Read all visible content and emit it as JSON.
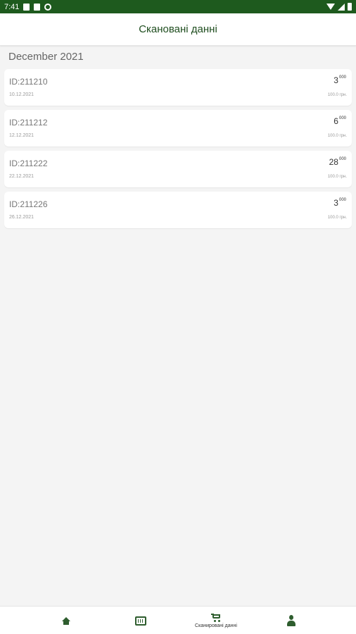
{
  "status_bar": {
    "time": "7:41"
  },
  "app_bar": {
    "title": "Скановані данні"
  },
  "section": {
    "header": "December 2021"
  },
  "items": [
    {
      "id": "ID:211210",
      "date": "10.12.2021",
      "amount": "3",
      "amount_fraction": "000",
      "price": "100.0 грн."
    },
    {
      "id": "ID:211212",
      "date": "12.12.2021",
      "amount": "6",
      "amount_fraction": "000",
      "price": "100.0 грн."
    },
    {
      "id": "ID:211222",
      "date": "22.12.2021",
      "amount": "28",
      "amount_fraction": "000",
      "price": "100.0 грн."
    },
    {
      "id": "ID:211226",
      "date": "26.12.2021",
      "amount": "3",
      "amount_fraction": "000",
      "price": "100.0 грн."
    }
  ],
  "bottom_nav": {
    "items": [
      {
        "icon": "home-icon",
        "label": ""
      },
      {
        "icon": "barcode-scan-icon",
        "label": ""
      },
      {
        "icon": "cart-icon",
        "label": "Сканировані данні",
        "active": true
      },
      {
        "icon": "user-icon",
        "label": ""
      }
    ]
  },
  "colors": {
    "primary": "#1e5a1e",
    "accent": "#2e5d2e",
    "background": "#f4f4f4"
  }
}
